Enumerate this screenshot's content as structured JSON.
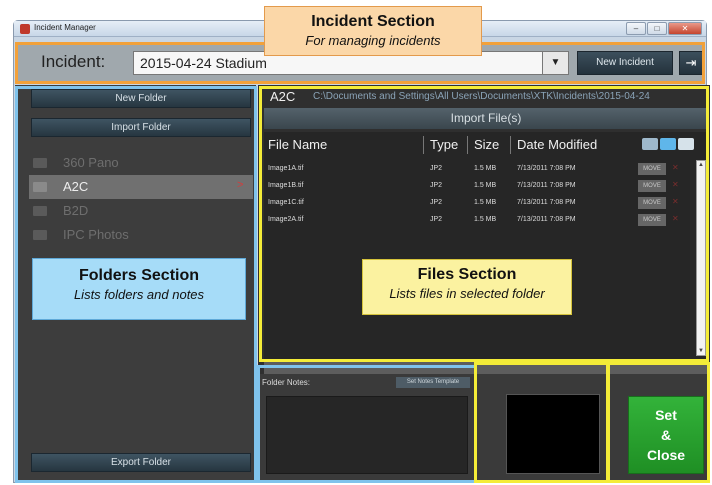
{
  "window": {
    "title": "Incident Manager",
    "controls": {
      "minimize": "–",
      "maximize": "□",
      "close": "✕"
    }
  },
  "incident": {
    "label": "Incident:",
    "selected": "2015-04-24 Stadium",
    "dropdown_arrow": "▼",
    "new_incident_label": "New Incident",
    "exit_icon": "exit-icon",
    "exit_glyph": "⇥"
  },
  "folders": {
    "new_folder_label": "New Folder",
    "import_folder_label": "Import Folder",
    "items": [
      {
        "name": "360 Pano",
        "mark": "",
        "selected": false
      },
      {
        "name": "A2C",
        "mark": ">",
        "selected": true
      },
      {
        "name": "B2D",
        "mark": "",
        "selected": false
      },
      {
        "name": "IPC Photos",
        "mark": "",
        "selected": false
      }
    ],
    "export_folder_label": "Export Folder"
  },
  "files": {
    "current_folder": "A2C",
    "path": "C:\\Documents and Settings\\All Users\\Documents\\XTK\\Incidents\\2015-04-24",
    "import_files_label": "Import File(s)",
    "columns": [
      "File Name",
      "Type",
      "Size",
      "Date Modified"
    ],
    "rows": [
      {
        "name": "Image1A.tif",
        "type": "JP2",
        "size": "1.5 MB",
        "date": "7/13/2011  7:08 PM",
        "action": "MOVE",
        "x": "✕"
      },
      {
        "name": "Image1B.tif",
        "type": "JP2",
        "size": "1.5 MB",
        "date": "7/13/2011  7:08 PM",
        "action": "MOVE",
        "x": "✕"
      },
      {
        "name": "Image1C.tif",
        "type": "JP2",
        "size": "1.5 MB",
        "date": "7/13/2011  7:08 PM",
        "action": "MOVE",
        "x": "✕"
      },
      {
        "name": "Image2A.tif",
        "type": "JP2",
        "size": "1.5 MB",
        "date": "7/13/2011  7:08 PM",
        "action": "MOVE",
        "x": "✕"
      }
    ],
    "scroll_up": "▲",
    "scroll_down": "▼"
  },
  "notes": {
    "label": "Folder Notes:",
    "set_template_label": "Set Notes Template"
  },
  "set_close": {
    "line1": "Set",
    "line2": "&",
    "line3": "Close"
  },
  "callouts": {
    "incident_title": "Incident Section",
    "incident_sub": "For managing incidents",
    "folders_title": "Folders Section",
    "folders_sub": "Lists folders and notes",
    "files_title": "Files Section",
    "files_sub": "Lists files in selected folder"
  }
}
